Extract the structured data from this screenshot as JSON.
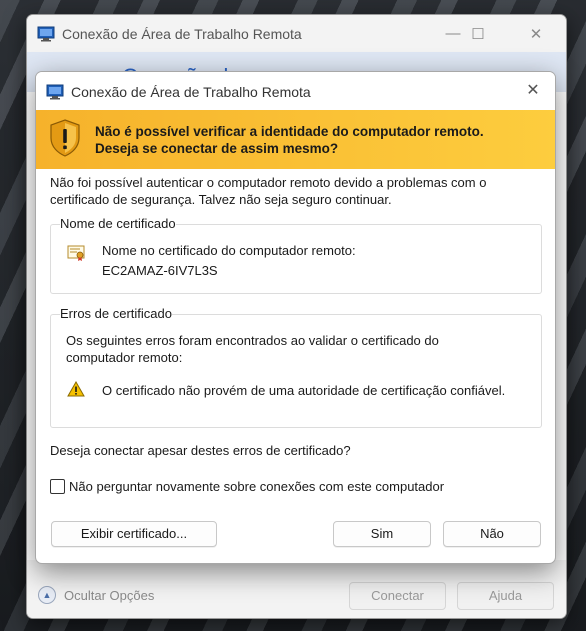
{
  "outer_window": {
    "title": "Conexão de Área de Trabalho Remota",
    "banner_text": "Conexão de...",
    "hide_options_label": "Ocultar Opções",
    "connect_label": "Conectar",
    "help_label": "Ajuda"
  },
  "dialog": {
    "title": "Conexão de Área de Trabalho Remota",
    "warning_line1": "Não é possível verificar a identidade do computador remoto.",
    "warning_line2": "Deseja se conectar de assim mesmo?",
    "intro_line1": "Não foi possível autenticar o computador remoto devido a problemas com o",
    "intro_line2": "certificado de segurança. Talvez não seja seguro continuar.",
    "cert_name_group": {
      "title": "Nome de certificado",
      "label": "Nome no certificado do computador remoto:",
      "value": "EC2AMAZ-6IV7L3S"
    },
    "cert_errors_group": {
      "title": "Erros de certificado",
      "desc_line1": "Os seguintes erros foram encontrados ao validar o certificado do",
      "desc_line2": "computador remoto:",
      "error": "O certificado não provém de uma autoridade de certificação confiável."
    },
    "question": "Deseja conectar apesar destes erros de certificado?",
    "checkbox_label": "Não perguntar novamente sobre conexões com este computador",
    "view_cert_label": "Exibir certificado...",
    "yes_label": "Sim",
    "no_label": "Não"
  },
  "colors": {
    "warning_banner": "#f6b22b",
    "accent_blue": "#2a63c5"
  }
}
